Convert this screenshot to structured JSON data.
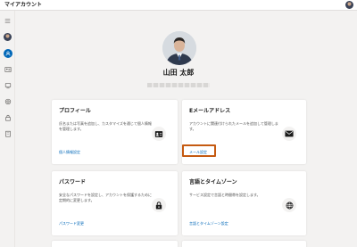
{
  "app": {
    "title": "マイアカウント"
  },
  "colors": {
    "accent": "#0067b8",
    "highlight": "#c55a11"
  },
  "sidebar": {
    "items": [
      {
        "icon": "home-icon"
      },
      {
        "icon": "person-icon",
        "active": true
      },
      {
        "icon": "id-card-icon"
      },
      {
        "icon": "devices-icon"
      },
      {
        "icon": "security-icon"
      },
      {
        "icon": "lock-icon"
      },
      {
        "icon": "building-icon"
      }
    ]
  },
  "profile": {
    "name": "山田 太郎"
  },
  "cards": {
    "profile": {
      "title": "プロフィール",
      "desc": "氏名または写真を追加し、カスタマイズを通じて個人情報を管理します。",
      "link": "個人情報設定",
      "icon": "contact-card-icon"
    },
    "email": {
      "title": "Eメールアドレス",
      "desc": "アカウントに関連付けられたメールを追加して管理します。",
      "link": "メール設定",
      "icon": "envelope-icon"
    },
    "password": {
      "title": "パスワード",
      "desc": "安全なパスワードを設定し、アカウントを保護するために定期的に変更します。",
      "link": "パスワード変更",
      "icon": "lock-icon"
    },
    "language": {
      "title": "言語とタイムゾーン",
      "desc": "サービス設定で言語と時間帯を設定します。",
      "link": "言語とタイムゾーン設定",
      "icon": "globe-icon"
    }
  }
}
